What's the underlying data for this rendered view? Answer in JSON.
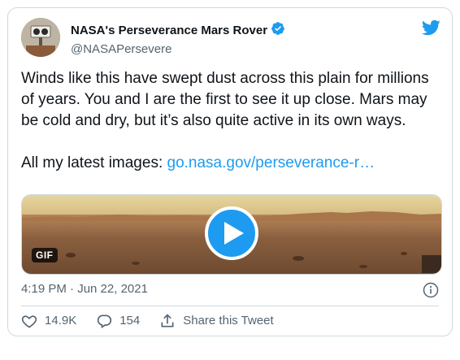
{
  "author": {
    "display_name": "NASA's Perseverance Mars Rover",
    "handle": "@NASAPersevere",
    "verified": true
  },
  "tweet": {
    "paragraph1": "Winds like this have swept dust across this plain for millions of years. You and I are the first to see it up close. Mars may be cold and dry, but it’s also quite active in its own ways.",
    "paragraph2_prefix": "All my latest images: ",
    "link_text": "go.nasa.gov/perseverance-r…"
  },
  "media": {
    "badge": "GIF"
  },
  "meta": {
    "timestamp": "4:19 PM · Jun 22, 2021"
  },
  "actions": {
    "like_count": "14.9K",
    "reply_count": "154",
    "share_label": "Share this Tweet"
  },
  "colors": {
    "accent": "#1d9bf0",
    "secondary_text": "#536471",
    "border": "#cfd9de"
  },
  "icons": {
    "brand": "twitter-bird-icon",
    "verified": "verified-badge-icon",
    "play": "play-icon",
    "info": "info-icon",
    "like": "heart-icon",
    "reply": "reply-bubble-icon",
    "share": "share-icon"
  }
}
